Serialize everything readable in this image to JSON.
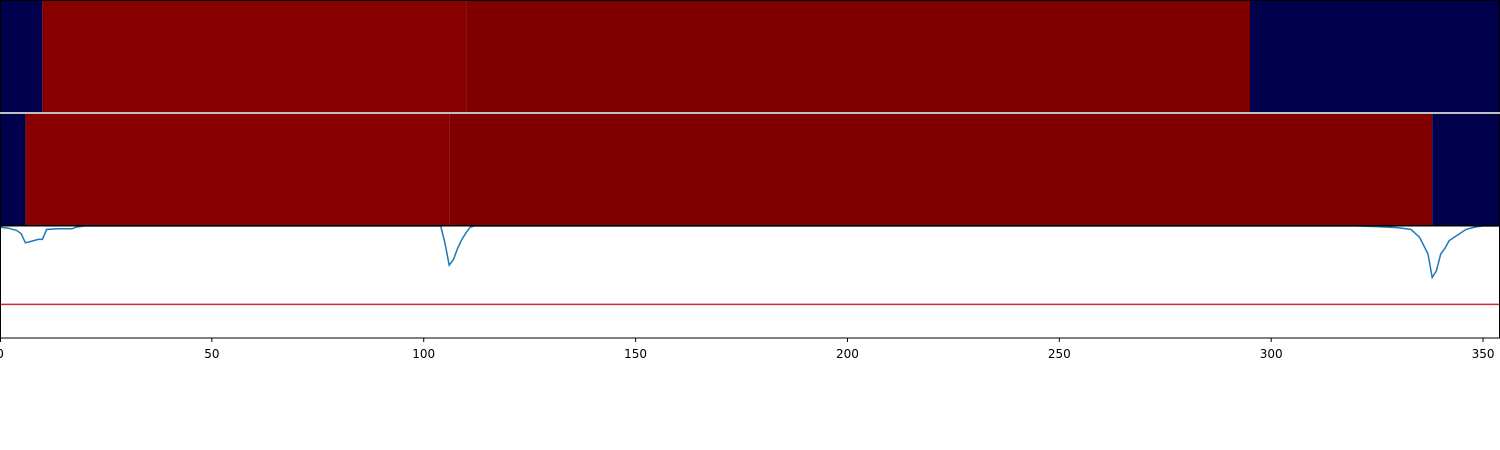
{
  "chart_data": {
    "type": "heatmap",
    "x_range": [
      0,
      354
    ],
    "x_ticks": [
      0,
      50,
      100,
      150,
      200,
      250,
      300,
      350
    ],
    "x_tick_labels": [
      "0",
      "50",
      "100",
      "150",
      "200",
      "250",
      "300",
      "350"
    ],
    "grid": false,
    "tracks": [
      {
        "segments": [
          {
            "x0": 0,
            "x1": 10,
            "color": "#00004c"
          },
          {
            "x0": 10,
            "x1": 110,
            "color": "#880000"
          },
          {
            "x0": 110,
            "x1": 295,
            "color": "#800000"
          },
          {
            "x0": 295,
            "x1": 354,
            "color": "#00004c"
          }
        ]
      },
      {
        "segments": [
          {
            "x0": 0,
            "x1": 6,
            "color": "#00004c"
          },
          {
            "x0": 6,
            "x1": 106,
            "color": "#880000"
          },
          {
            "x0": 106,
            "x1": 338,
            "color": "#800000"
          },
          {
            "x0": 338,
            "x1": 354,
            "color": "#00004c"
          }
        ]
      }
    ],
    "line_panel": {
      "ylim": [
        0,
        1
      ],
      "threshold": {
        "y": 0.3,
        "color": "#d62728"
      },
      "series": {
        "color": "#1f77b4",
        "points": [
          [
            0,
            0.99
          ],
          [
            2,
            0.98
          ],
          [
            4,
            0.96
          ],
          [
            5,
            0.93
          ],
          [
            6,
            0.85
          ],
          [
            8,
            0.87
          ],
          [
            9,
            0.88
          ],
          [
            10,
            0.88
          ],
          [
            11,
            0.97
          ],
          [
            14,
            0.975
          ],
          [
            17,
            0.975
          ],
          [
            18,
            0.99
          ],
          [
            20,
            1.0
          ],
          [
            104,
            1.0
          ],
          [
            105,
            0.85
          ],
          [
            106,
            0.65
          ],
          [
            107,
            0.7
          ],
          [
            108,
            0.8
          ],
          [
            109,
            0.88
          ],
          [
            110,
            0.94
          ],
          [
            111,
            0.99
          ],
          [
            112,
            1.0
          ],
          [
            320,
            1.0
          ],
          [
            325,
            0.995
          ],
          [
            330,
            0.985
          ],
          [
            333,
            0.97
          ],
          [
            335,
            0.9
          ],
          [
            337,
            0.75
          ],
          [
            338,
            0.54
          ],
          [
            339,
            0.6
          ],
          [
            340,
            0.75
          ],
          [
            341,
            0.8
          ],
          [
            342,
            0.87
          ],
          [
            344,
            0.92
          ],
          [
            346,
            0.97
          ],
          [
            348,
            0.99
          ],
          [
            350,
            1.0
          ],
          [
            354,
            1.0
          ]
        ]
      }
    }
  }
}
